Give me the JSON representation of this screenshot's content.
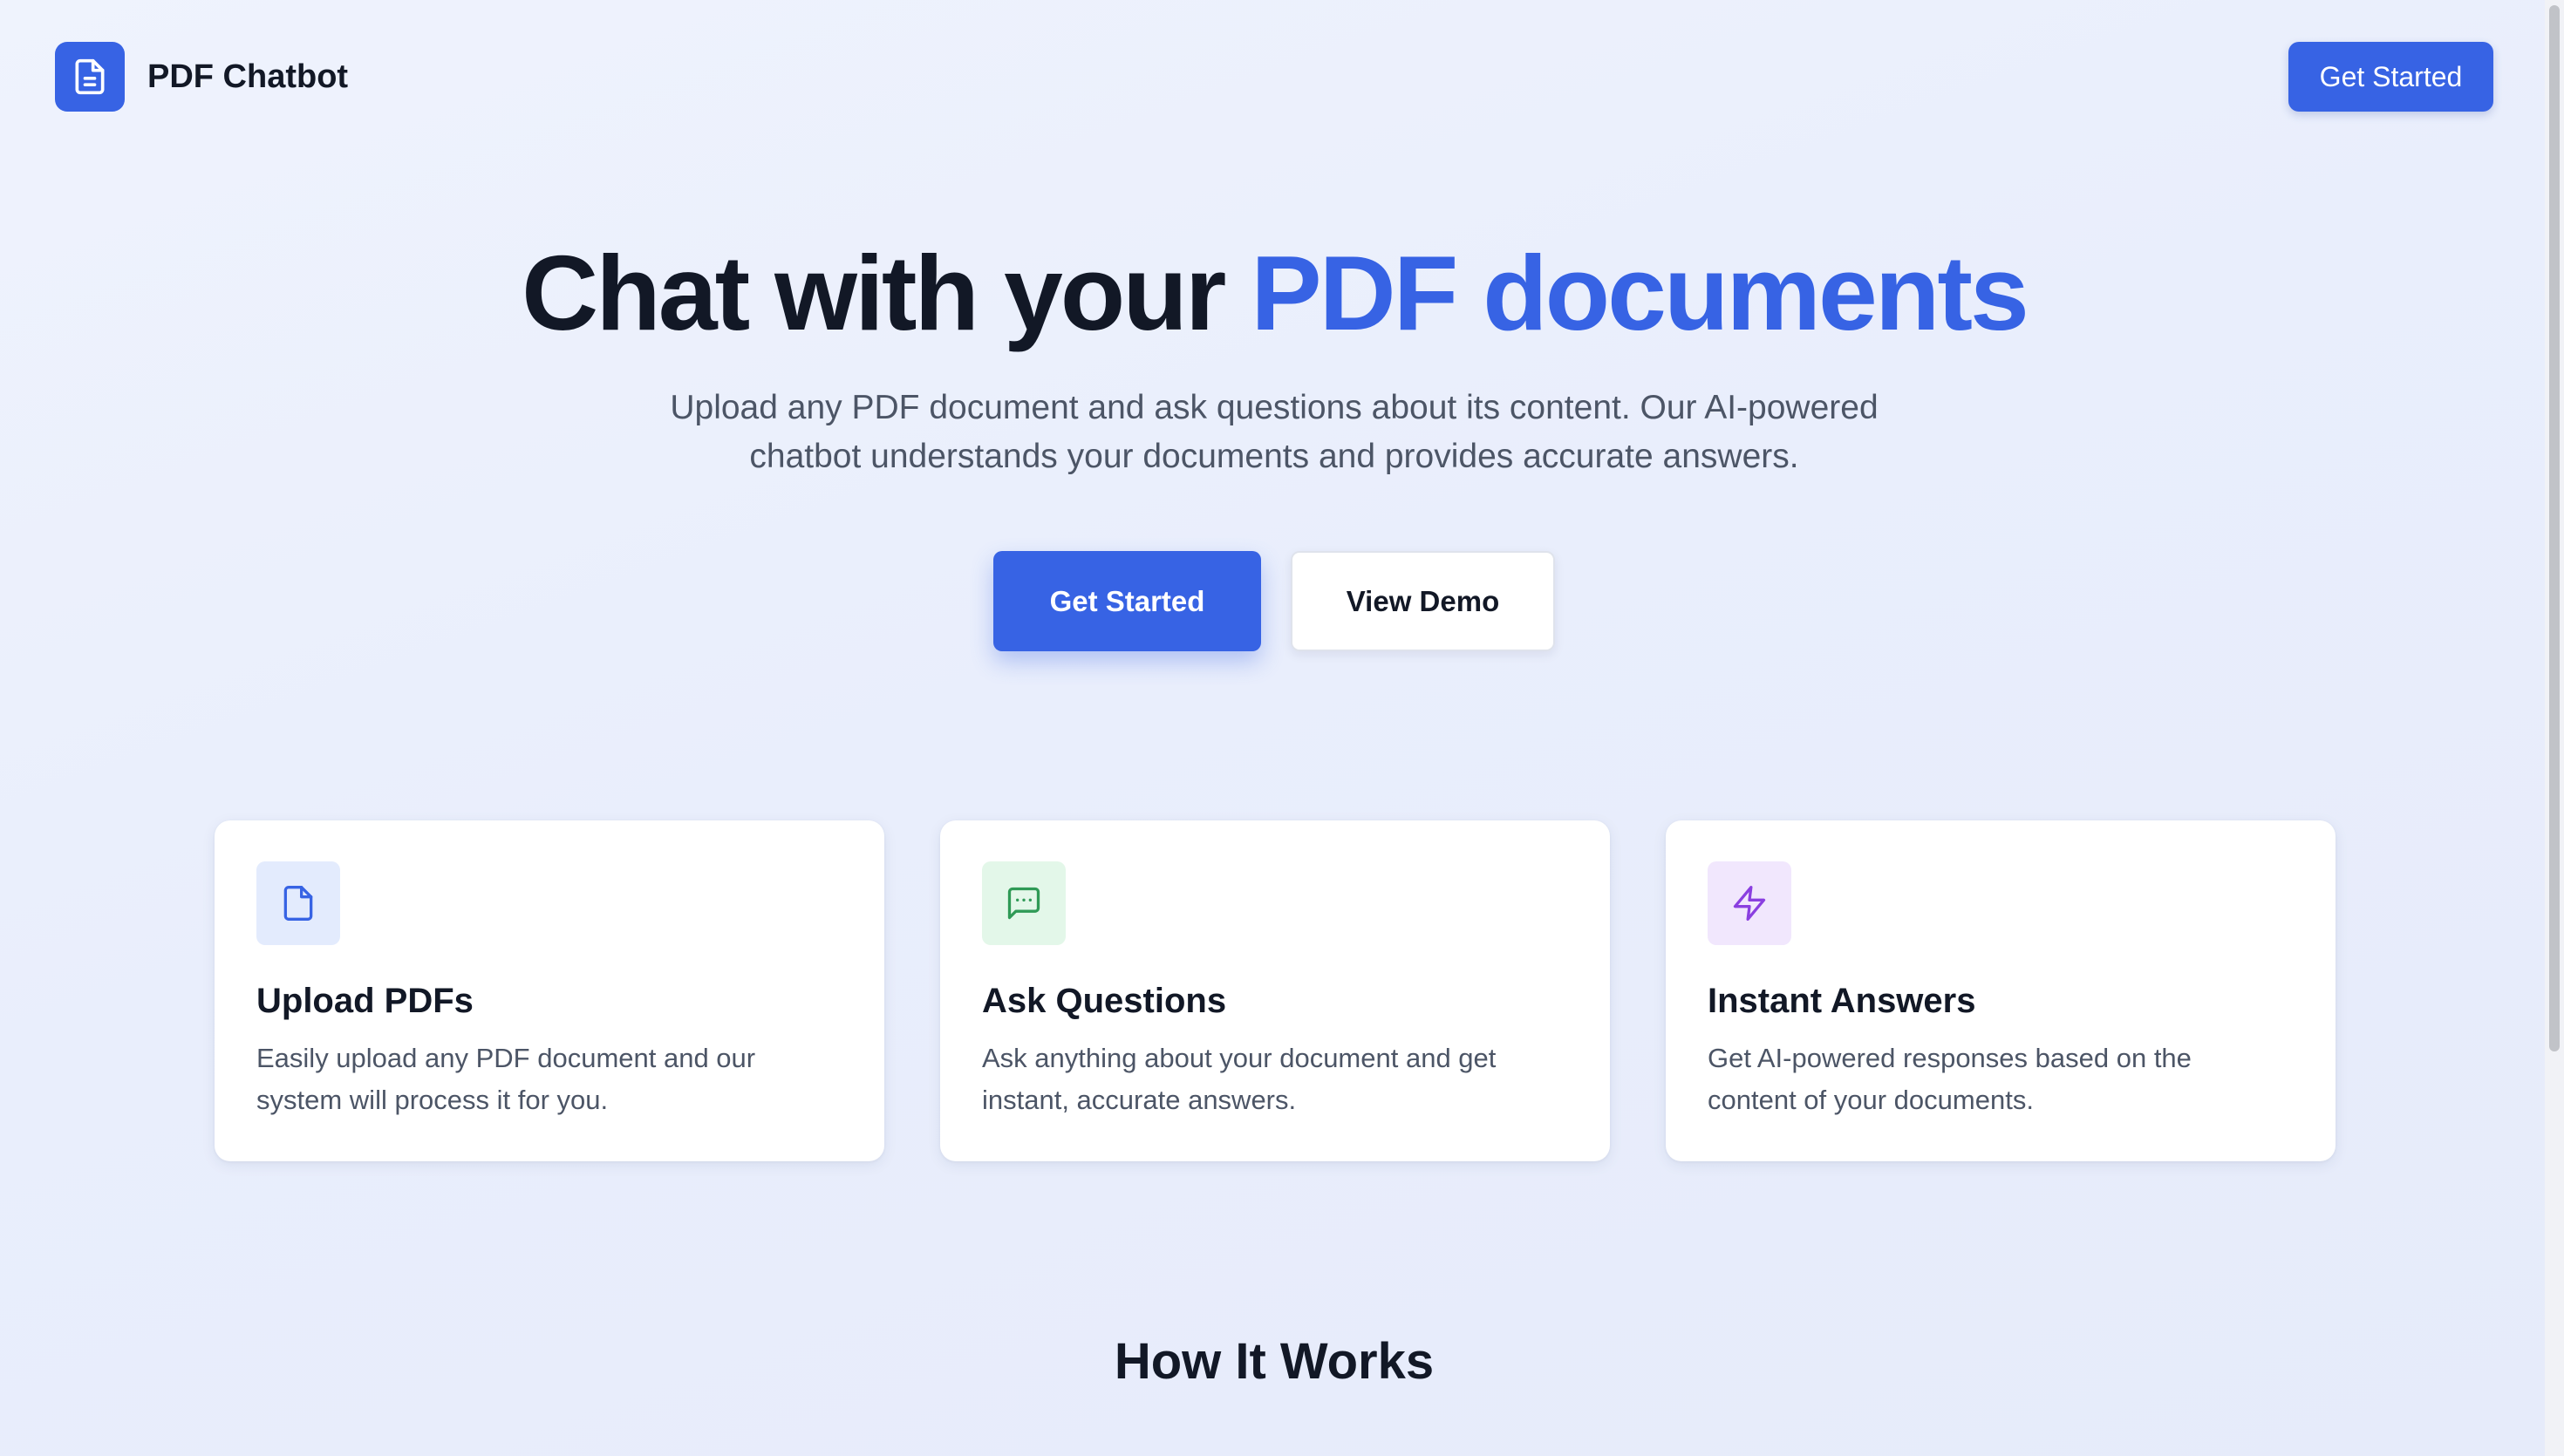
{
  "header": {
    "brand": "PDF Chatbot",
    "brand_icon": "document-icon",
    "cta_label": "Get Started"
  },
  "hero": {
    "title_main": "Chat with your ",
    "title_accent": "PDF documents",
    "subtitle_line1": "Upload any PDF document and ask questions about its content. Our AI-powered",
    "subtitle_line2": "chatbot understands your documents and provides accurate answers.",
    "primary_label": "Get Started",
    "secondary_label": "View Demo"
  },
  "features": [
    {
      "icon": "file-icon",
      "title": "Upload PDFs",
      "description": "Easily upload any PDF document and our system will process it for you."
    },
    {
      "icon": "message-icon",
      "title": "Ask Questions",
      "description": "Ask anything about your document and get instant, accurate answers."
    },
    {
      "icon": "lightning-icon",
      "title": "Instant Answers",
      "description": "Get AI-powered responses based on the content of your documents."
    }
  ],
  "how_it_works": {
    "title": "How It Works"
  },
  "colors": {
    "accent": "#3763e4",
    "heading": "#121826",
    "body_text": "#4c5566",
    "upload_icon_bg": "#e3ebfd",
    "ask_icon_bg": "#e3f7e9",
    "instant_icon_bg": "#f1e7fd"
  }
}
